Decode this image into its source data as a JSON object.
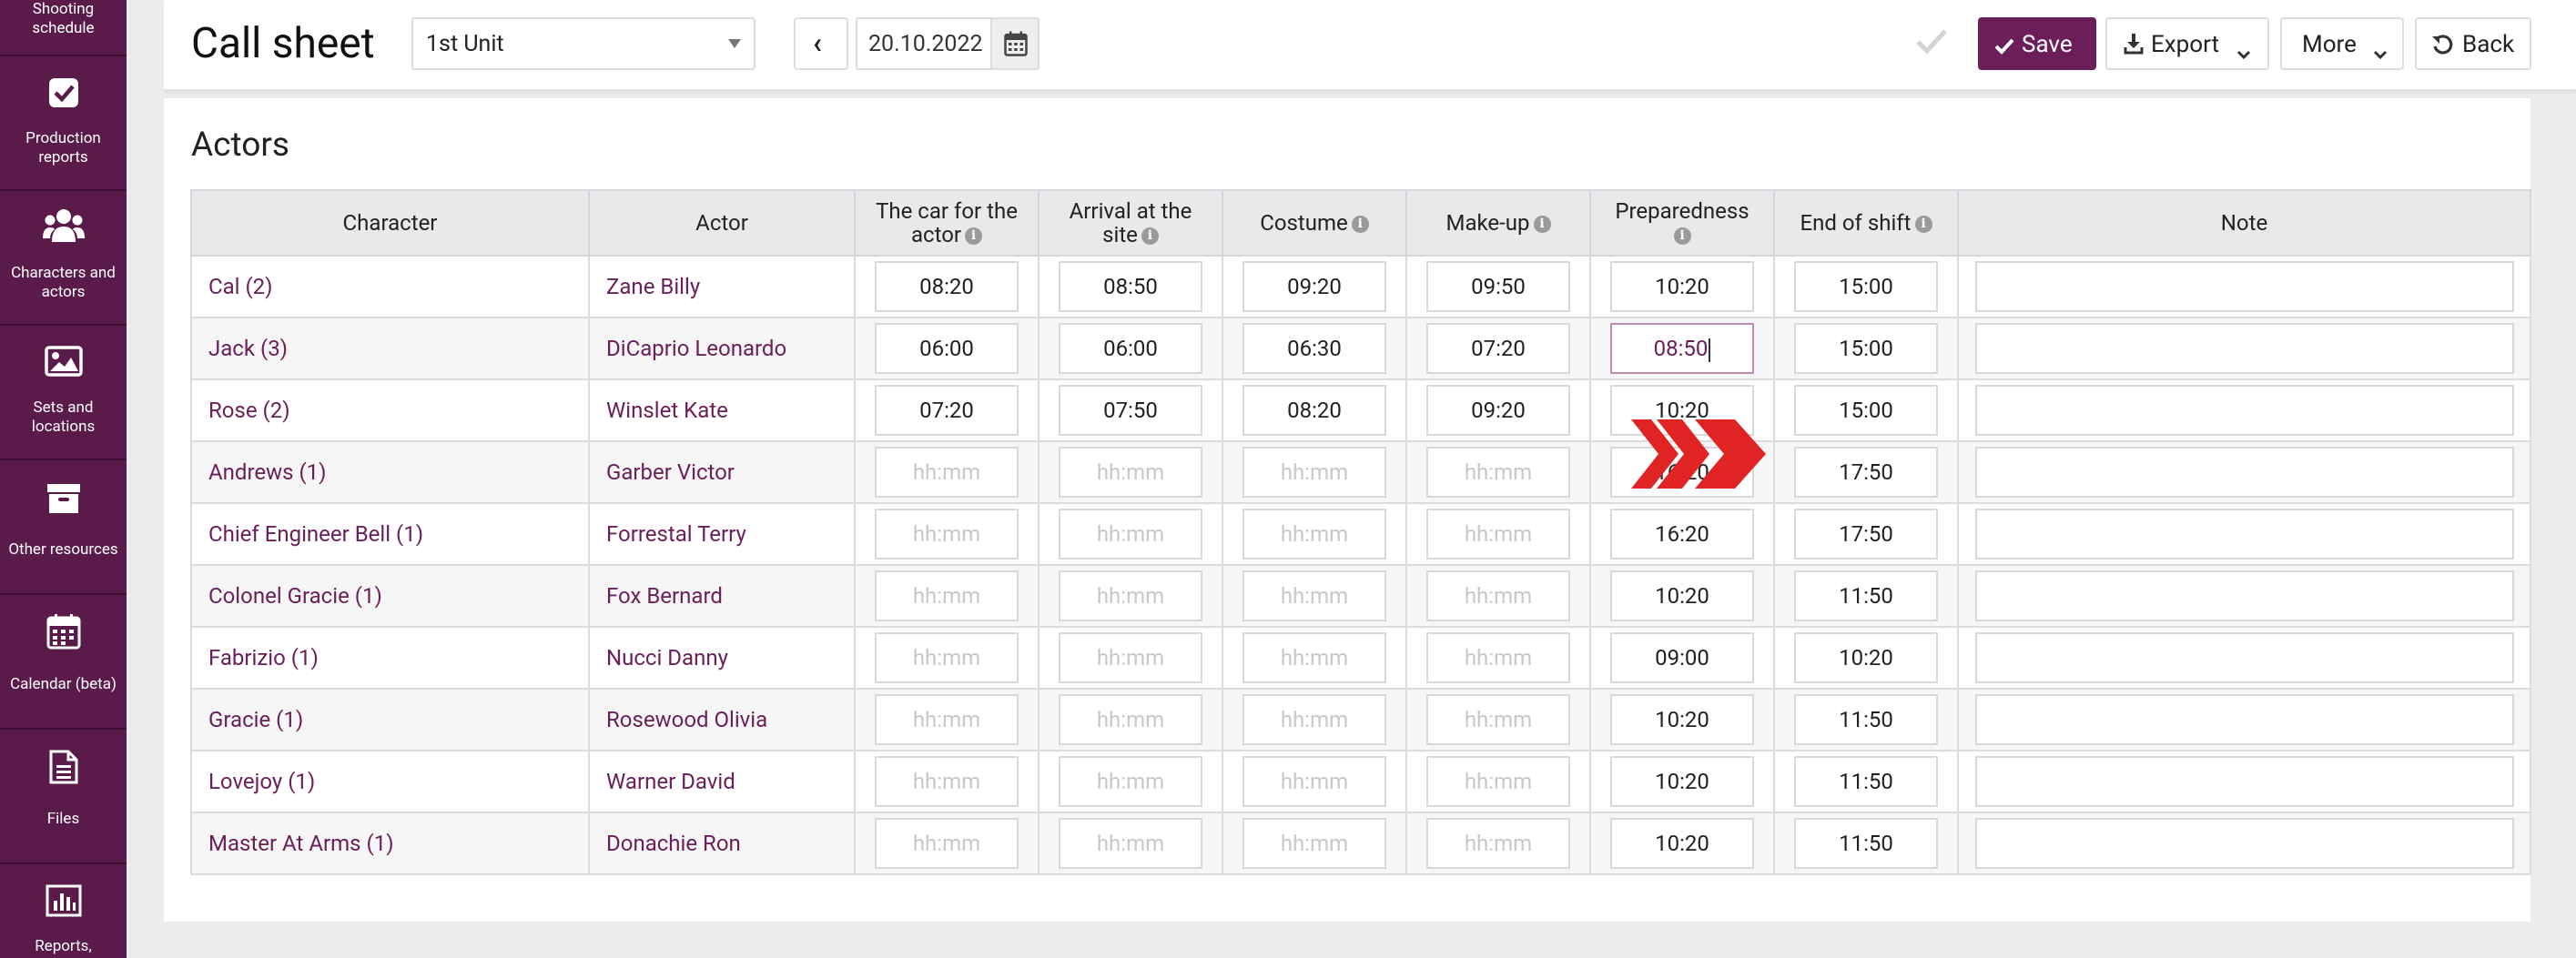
{
  "sidebar": {
    "items": [
      {
        "label_line1": "Shooting",
        "label_line2": "schedule",
        "icon": "calendar-icon"
      },
      {
        "label_line1": "Production",
        "label_line2": "reports",
        "icon": "checkbox-icon"
      },
      {
        "label_line1": "Characters and",
        "label_line2": "actors",
        "icon": "users-icon"
      },
      {
        "label_line1": "Sets and",
        "label_line2": "locations",
        "icon": "image-icon"
      },
      {
        "label_line1": "Other resources",
        "label_line2": "",
        "icon": "archive-icon"
      },
      {
        "label_line1": "Calendar (beta)",
        "label_line2": "",
        "icon": "calendar-grid-icon"
      },
      {
        "label_line1": "Files",
        "label_line2": "",
        "icon": "file-icon"
      },
      {
        "label_line1": "Reports,",
        "label_line2": "",
        "icon": "bar-chart-icon"
      }
    ]
  },
  "header": {
    "title": "Call sheet",
    "unit_select": "1st Unit",
    "prev_label": "‹",
    "date": "20.10.2022",
    "save_label": "Save",
    "export_label": "Export",
    "more_label": "More",
    "back_label": "Back"
  },
  "section": {
    "title": "Actors"
  },
  "table": {
    "columns": {
      "character": "Character",
      "actor": "Actor",
      "car_line1": "The car for the",
      "car_line2": "actor",
      "arrival_line1": "Arrival at the",
      "arrival_line2": "site",
      "costume": "Costume",
      "makeup": "Make-up",
      "preparedness": "Preparedness",
      "end_of_shift": "End of shift",
      "note": "Note"
    },
    "placeholder": "hh:mm",
    "rows": [
      {
        "character": "Cal (2)",
        "actor": "Zane Billy",
        "car": "08:20",
        "arrival": "08:50",
        "costume": "09:20",
        "makeup": "09:50",
        "preparedness": "10:20",
        "end": "15:00"
      },
      {
        "character": "Jack (3)",
        "actor": "DiCaprio Leonardo",
        "car": "06:00",
        "arrival": "06:00",
        "costume": "06:30",
        "makeup": "07:20",
        "preparedness": "08:50",
        "end": "15:00"
      },
      {
        "character": "Rose (2)",
        "actor": "Winslet Kate",
        "car": "07:20",
        "arrival": "07:50",
        "costume": "08:20",
        "makeup": "09:20",
        "preparedness": "10:20",
        "end": "15:00"
      },
      {
        "character": "Andrews (1)",
        "actor": "Garber Victor",
        "car": "",
        "arrival": "",
        "costume": "",
        "makeup": "",
        "preparedness": "16:20",
        "end": "17:50"
      },
      {
        "character": "Chief Engineer Bell (1)",
        "actor": "Forrestal Terry",
        "car": "",
        "arrival": "",
        "costume": "",
        "makeup": "",
        "preparedness": "16:20",
        "end": "17:50"
      },
      {
        "character": "Colonel Gracie (1)",
        "actor": "Fox Bernard",
        "car": "",
        "arrival": "",
        "costume": "",
        "makeup": "",
        "preparedness": "10:20",
        "end": "11:50"
      },
      {
        "character": "Fabrizio (1)",
        "actor": "Nucci Danny",
        "car": "",
        "arrival": "",
        "costume": "",
        "makeup": "",
        "preparedness": "09:00",
        "end": "10:20"
      },
      {
        "character": "Gracie (1)",
        "actor": "Rosewood Olivia",
        "car": "",
        "arrival": "",
        "costume": "",
        "makeup": "",
        "preparedness": "10:20",
        "end": "11:50"
      },
      {
        "character": "Lovejoy (1)",
        "actor": "Warner David",
        "car": "",
        "arrival": "",
        "costume": "",
        "makeup": "",
        "preparedness": "10:20",
        "end": "11:50"
      },
      {
        "character": "Master At Arms (1)",
        "actor": "Donachie Ron",
        "car": "",
        "arrival": "",
        "costume": "",
        "makeup": "",
        "preparedness": "10:20",
        "end": "11:50"
      }
    ]
  },
  "colors": {
    "brand": "#6b1e5a",
    "sidebar": "#5a1b4a",
    "arrow": "#e02424"
  }
}
